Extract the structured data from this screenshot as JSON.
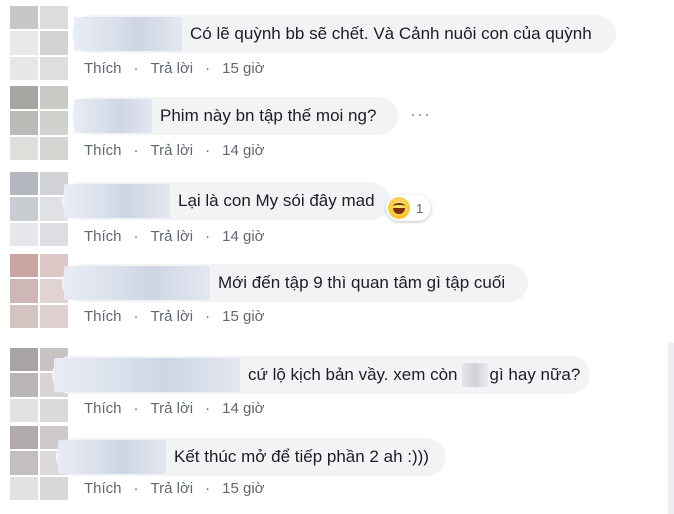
{
  "comments": [
    {
      "text": "Có lẽ quỳnh bb sẽ chết. Và Cảnh nuôi con của quỳnh",
      "like": "Thích",
      "reply": "Trả lời",
      "time": "15 giờ"
    },
    {
      "text": "Phim này bn tập thế moi ng?",
      "like": "Thích",
      "reply": "Trả lời",
      "time": "14 giờ",
      "more_icon": "ellipsis-icon"
    },
    {
      "text": "Lại là con My sói đây mad",
      "like": "Thích",
      "reply": "Trả lời",
      "time": "14 giờ",
      "reaction": {
        "icon": "haha-emoji-icon",
        "count": "1"
      }
    },
    {
      "text": "Mới đến tập 9 thì quan tâm gì tập cuối",
      "like": "Thích",
      "reply": "Trả lời",
      "time": "15 giờ"
    },
    {
      "text_part1": "cứ lộ kịch bản vầy. xem còn",
      "text_part2": "gì hay nữa?",
      "like": "Thích",
      "reply": "Trả lời",
      "time": "14 giờ"
    },
    {
      "text": "Kết thúc mở để tiếp phần 2 ah :)))",
      "like": "Thích",
      "reply": "Trả lời",
      "time": "15 giờ"
    }
  ],
  "separator": "·",
  "colors": {
    "bubble": "#f2f3f5",
    "meta_text": "#606770",
    "body_text": "#1c1e21"
  }
}
